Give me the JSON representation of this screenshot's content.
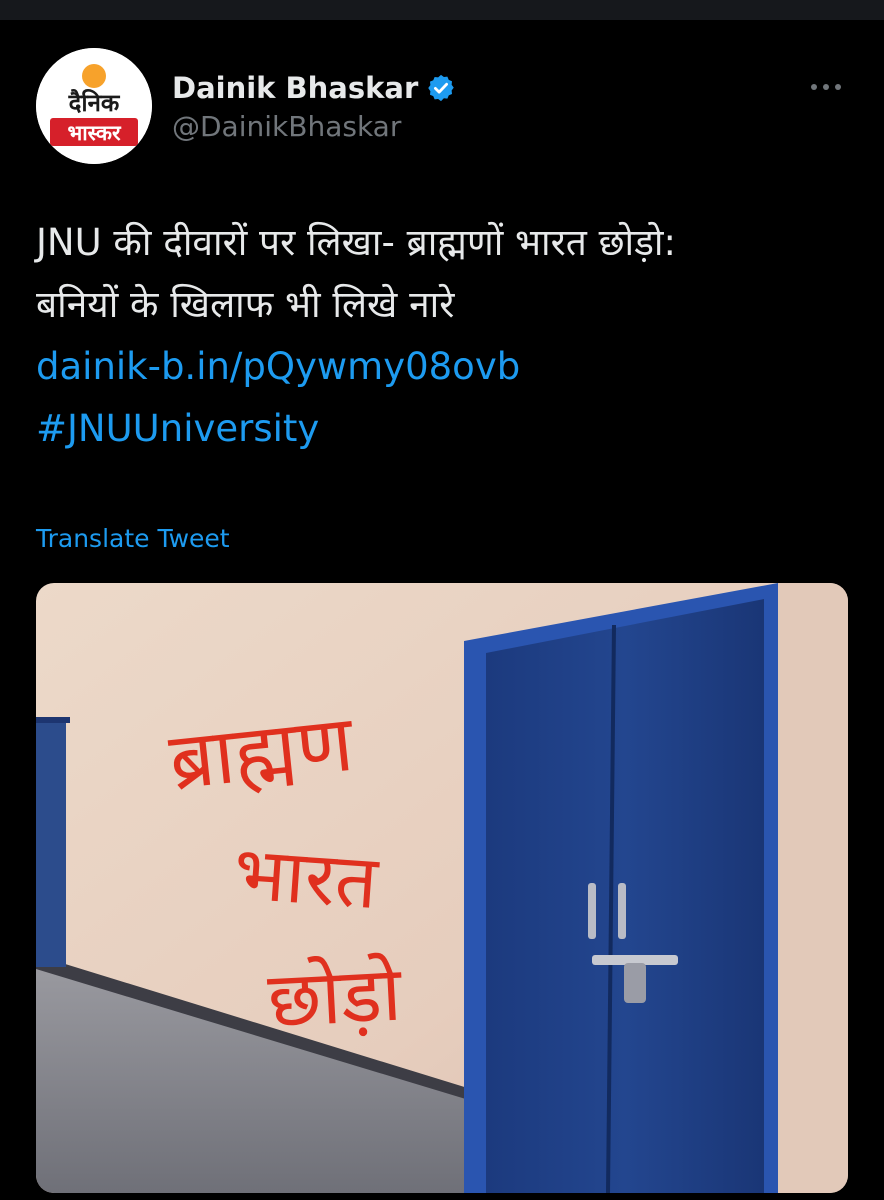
{
  "author": {
    "display_name": "Dainik Bhaskar",
    "handle": "@DainikBhaskar",
    "verified": true,
    "avatar_logo_text": [
      "दैनिक",
      "भास्कर"
    ]
  },
  "tweet": {
    "text_lines": [
      "JNU की दीवारों पर लिखा- ब्राह्मणों भारत छोड़ो:",
      "बनियों के खिलाफ भी लिखे नारे"
    ],
    "link": "dainik-b.in/pQywmy08ovb",
    "hashtag": "#JNUUniversity",
    "translate_label": "Translate Tweet"
  },
  "media": {
    "graffiti_text": [
      "ब्राह्मण",
      "भारत",
      "छोड़ो"
    ]
  },
  "icons": {
    "verified": "verified-badge-icon",
    "more": "more-options-icon"
  },
  "colors": {
    "background": "#000000",
    "text_primary": "#e7e9ea",
    "text_secondary": "#71767b",
    "accent_blue": "#1d9bf0",
    "logo_orange": "#f7a22b",
    "logo_red": "#d6202a",
    "graffiti_red": "#e0301e",
    "door_blue": "#1f3f86"
  }
}
